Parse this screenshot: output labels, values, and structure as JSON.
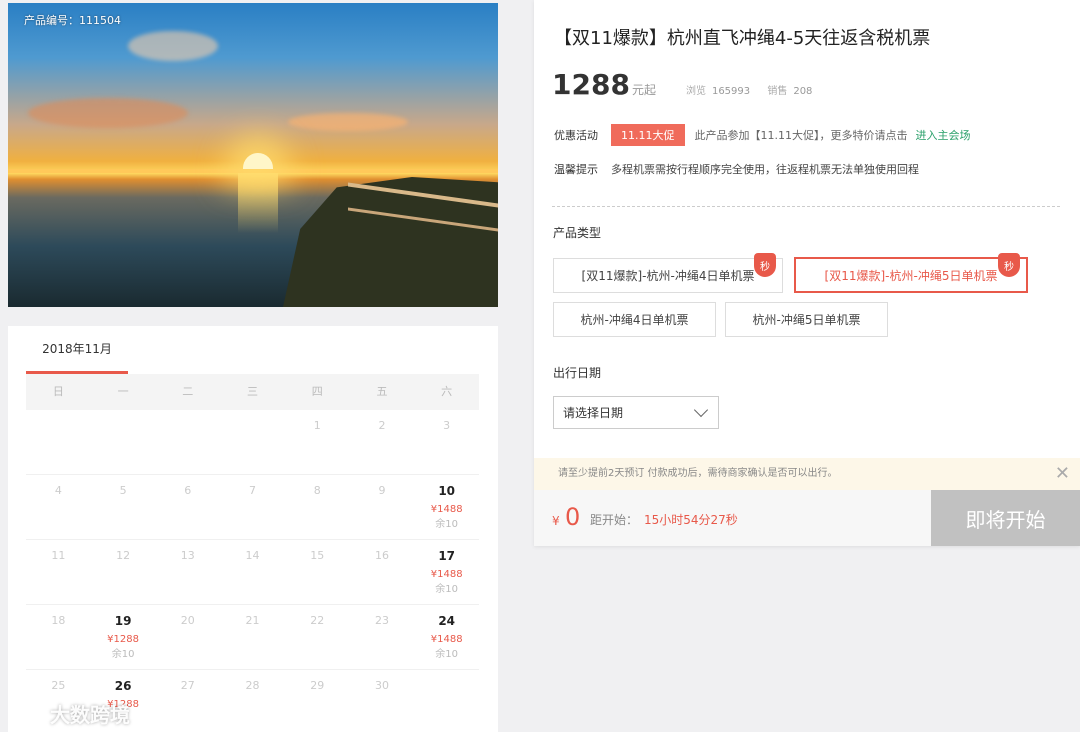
{
  "photo": {
    "product_code_label": "产品编号：111504"
  },
  "calendar": {
    "month_tab": "2018年11月",
    "weekdays": [
      "日",
      "一",
      "二",
      "三",
      "四",
      "五",
      "六"
    ],
    "weeks": [
      [
        {
          "d": ""
        },
        {
          "d": ""
        },
        {
          "d": ""
        },
        {
          "d": ""
        },
        {
          "d": "1"
        },
        {
          "d": "2"
        },
        {
          "d": "3"
        }
      ],
      [
        {
          "d": "4"
        },
        {
          "d": "5"
        },
        {
          "d": "6"
        },
        {
          "d": "7"
        },
        {
          "d": "8"
        },
        {
          "d": "9"
        },
        {
          "d": "10",
          "price": "¥1488",
          "remain": "余10"
        }
      ],
      [
        {
          "d": "11"
        },
        {
          "d": "12"
        },
        {
          "d": "13"
        },
        {
          "d": "14"
        },
        {
          "d": "15"
        },
        {
          "d": "16"
        },
        {
          "d": "17",
          "price": "¥1488",
          "remain": "余10"
        }
      ],
      [
        {
          "d": "18"
        },
        {
          "d": "19",
          "price": "¥1288",
          "remain": "余10"
        },
        {
          "d": "20"
        },
        {
          "d": "21"
        },
        {
          "d": "22"
        },
        {
          "d": "23"
        },
        {
          "d": "24",
          "price": "¥1488",
          "remain": "余10"
        }
      ],
      [
        {
          "d": "25"
        },
        {
          "d": "26",
          "price": "¥1288"
        },
        {
          "d": "27"
        },
        {
          "d": "28"
        },
        {
          "d": "29"
        },
        {
          "d": "30"
        },
        {
          "d": ""
        }
      ]
    ]
  },
  "watermark": "大数跨境",
  "product": {
    "title": "【双11爆款】杭州直飞冲绳4-5天往返含税机票",
    "price": "1288",
    "price_unit": "元起",
    "views_label": "浏览",
    "views": "165993",
    "sales_label": "销售",
    "sales": "208"
  },
  "promo": {
    "label": "优惠活动",
    "badge": "11.11大促",
    "text": "此产品参加【11.11大促】，更多特价请点击",
    "link": "进入主会场"
  },
  "tip": {
    "label": "温馨提示",
    "text": "多程机票需按行程顺序完全使用，往返程机票无法单独使用回程"
  },
  "type_section": {
    "label": "产品类型",
    "options": [
      "[双11爆款]-杭州-冲绳4日单机票",
      "[双11爆款]-杭州-冲绳5日单机票",
      "杭州-冲绳4日单机票",
      "杭州-冲绳5日单机票"
    ],
    "flash_badge": "秒"
  },
  "date_section": {
    "label": "出行日期",
    "select_value": "请选择日期"
  },
  "notice": {
    "text": "请至少提前2天预订 付款成功后，需待商家确认是否可以出行。",
    "close": "✕"
  },
  "bottom": {
    "yen": "¥",
    "amount": "0",
    "countdown_label": "距开始：",
    "countdown": "15小时54分27秒",
    "button": "即将开始"
  }
}
